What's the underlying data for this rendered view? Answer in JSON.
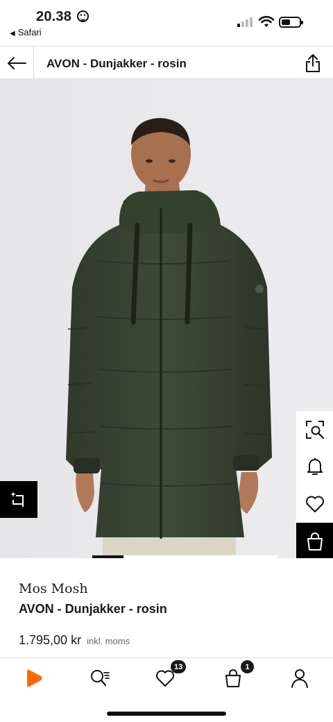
{
  "status_bar": {
    "time": "20.38",
    "back_app": "Safari"
  },
  "header": {
    "title": "AVON - Dunjakker - rosin"
  },
  "product": {
    "brand": "Mos Mosh",
    "name": "AVON - Dunjakker - rosin",
    "price": "1.795,00 kr",
    "vat_note": "inkl. moms"
  },
  "image": {
    "carousel_position": 0.15
  },
  "side_actions": [
    "similar-search-icon",
    "bell-icon",
    "heart-icon",
    "shopping-bag-icon"
  ],
  "tab_bar": {
    "items": [
      "home-icon",
      "search-icon",
      "wishlist-icon",
      "cart-icon",
      "profile-icon"
    ],
    "wishlist_count": "13",
    "cart_count": "1"
  },
  "colors": {
    "accent": "#ff6900",
    "jacket": "#3a4534",
    "background": "#e9e9eb"
  }
}
